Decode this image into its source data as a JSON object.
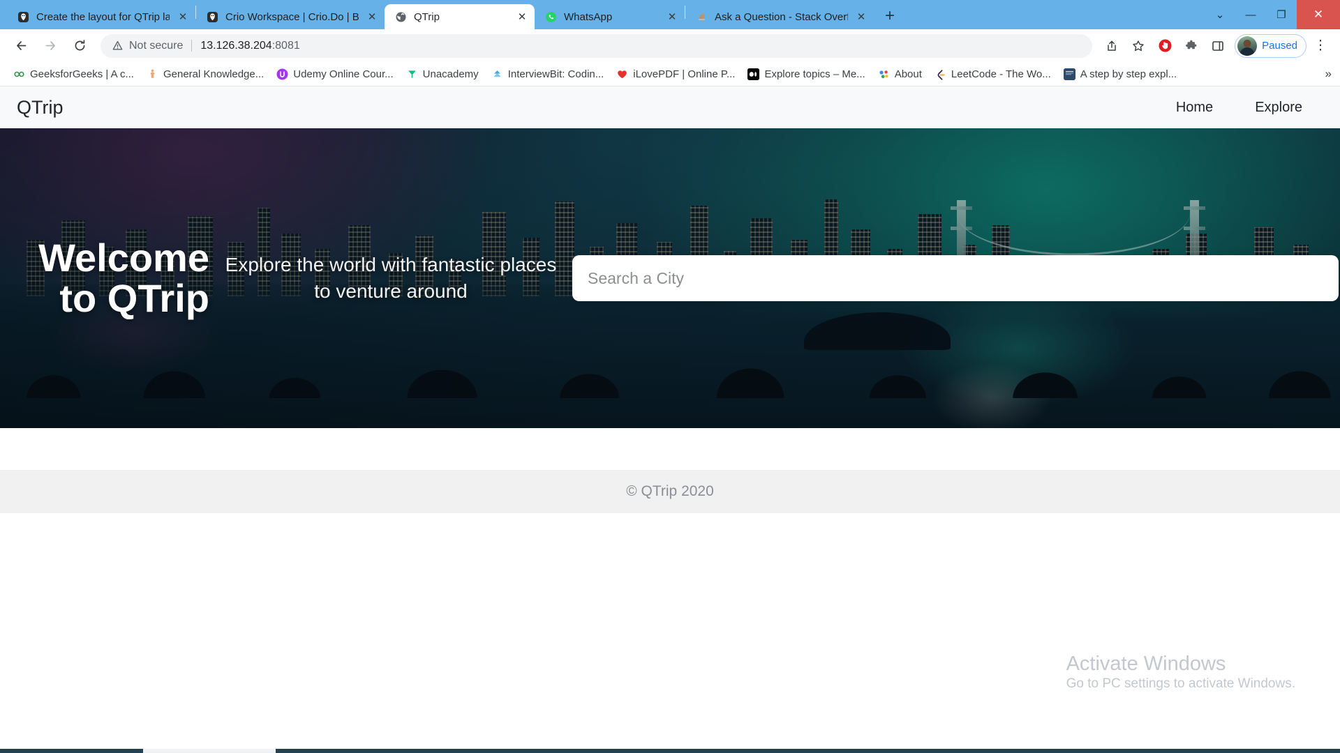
{
  "browser": {
    "tabs": [
      {
        "title": "Create the layout for QTrip landin",
        "favicon": "crio-icon",
        "active": false
      },
      {
        "title": "Crio Workspace | Crio.Do | Build ",
        "favicon": "crio-icon",
        "active": false
      },
      {
        "title": "QTrip",
        "favicon": "globe-icon",
        "active": true
      },
      {
        "title": "WhatsApp",
        "favicon": "whatsapp-icon",
        "active": false
      },
      {
        "title": "Ask a Question - Stack Overflow",
        "favicon": "stackoverflow-icon",
        "active": false
      }
    ],
    "new_tab_label": "+",
    "close_tab_label": "✕",
    "window_controls": {
      "tab_search": "⌄",
      "minimize": "—",
      "restore": "❐",
      "close": "✕"
    },
    "toolbar": {
      "back_label": "←",
      "forward_label": "→",
      "reload_label": "⟳",
      "security_label": "Not secure",
      "url_host": "13.126.38.204",
      "url_port": ":8081",
      "share_label": "share-icon",
      "bookmark_label": "star-icon",
      "adblock_label": "adblock-icon",
      "extensions_label": "puzzle-icon",
      "sidepanel_label": "side-panel-icon",
      "profile_status": "Paused",
      "menu_label": "⋮"
    },
    "bookmarks": [
      {
        "label": "GeeksforGeeks | A c...",
        "icon": "gfg-icon"
      },
      {
        "label": "General Knowledge...",
        "icon": "gk-icon"
      },
      {
        "label": "Udemy Online Cour...",
        "icon": "udemy-icon"
      },
      {
        "label": "Unacademy",
        "icon": "unacademy-icon"
      },
      {
        "label": "InterviewBit: Codin...",
        "icon": "interviewbit-icon"
      },
      {
        "label": "iLovePDF | Online P...",
        "icon": "ilovepdf-icon"
      },
      {
        "label": "Explore topics – Me...",
        "icon": "medium-icon"
      },
      {
        "label": "About",
        "icon": "about-icon"
      },
      {
        "label": "LeetCode - The Wo...",
        "icon": "leetcode-icon"
      },
      {
        "label": "A step by step expl...",
        "icon": "article-icon"
      }
    ],
    "bookmarks_overflow": "»"
  },
  "page": {
    "nav": {
      "brand": "QTrip",
      "links": [
        {
          "label": "Home"
        },
        {
          "label": "Explore"
        }
      ]
    },
    "hero": {
      "title": "Welcome to QTrip",
      "subtitle": "Explore the world with fantastic places to venture around",
      "search_placeholder": "Search a City",
      "search_value": ""
    },
    "footer": {
      "copyright": "© QTrip 2020"
    }
  },
  "os": {
    "watermark_title": "Activate Windows",
    "watermark_subtitle": "Go to PC settings to activate Windows."
  },
  "colors": {
    "tabstrip": "#66b2e8",
    "close_button": "#d9534f",
    "link_blue": "#1a73e8",
    "site_nav_bg": "#f8f9fa",
    "footer_bg": "#f1f1f1"
  }
}
